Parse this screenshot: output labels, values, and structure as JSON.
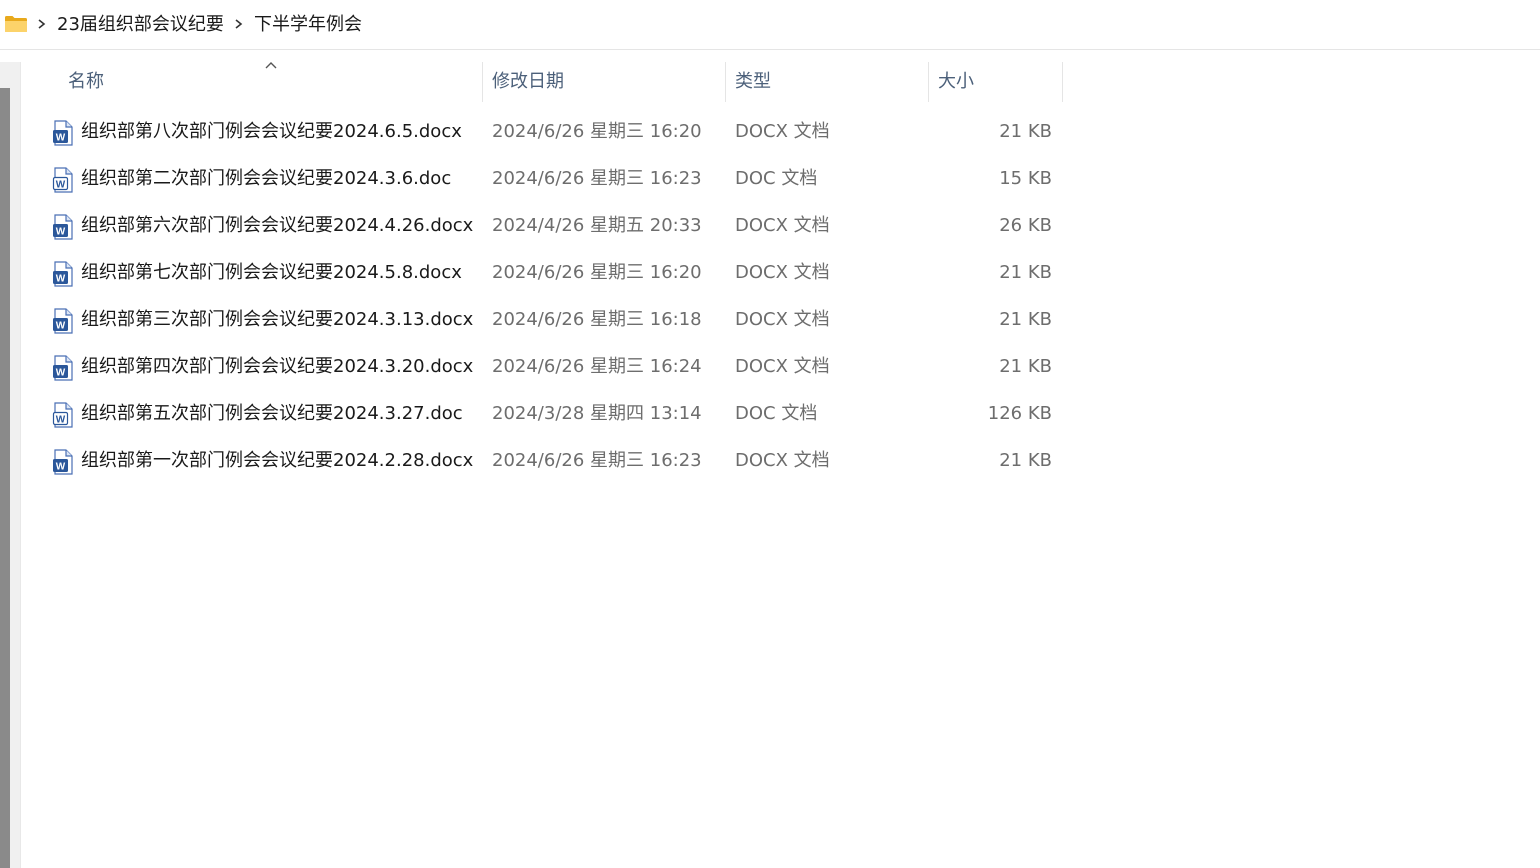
{
  "breadcrumb": {
    "items": [
      "23届组织部会议纪要",
      "下半学年例会"
    ]
  },
  "columns": {
    "name": "名称",
    "date": "修改日期",
    "type": "类型",
    "size": "大小"
  },
  "files": [
    {
      "name": "组织部第八次部门例会会议纪要2024.6.5.docx",
      "date": "2024/6/26 星期三 16:20",
      "type": "DOCX 文档",
      "size": "21 KB",
      "icon": "docx-icon"
    },
    {
      "name": "组织部第二次部门例会会议纪要2024.3.6.doc",
      "date": "2024/6/26 星期三 16:23",
      "type": "DOC 文档",
      "size": "15 KB",
      "icon": "doc-icon"
    },
    {
      "name": "组织部第六次部门例会会议纪要2024.4.26.docx",
      "date": "2024/4/26 星期五 20:33",
      "type": "DOCX 文档",
      "size": "26 KB",
      "icon": "docx-icon"
    },
    {
      "name": "组织部第七次部门例会会议纪要2024.5.8.docx",
      "date": "2024/6/26 星期三 16:20",
      "type": "DOCX 文档",
      "size": "21 KB",
      "icon": "docx-icon"
    },
    {
      "name": "组织部第三次部门例会会议纪要2024.3.13.docx",
      "date": "2024/6/26 星期三 16:18",
      "type": "DOCX 文档",
      "size": "21 KB",
      "icon": "docx-icon"
    },
    {
      "name": "组织部第四次部门例会会议纪要2024.3.20.docx",
      "date": "2024/6/26 星期三 16:24",
      "type": "DOCX 文档",
      "size": "21 KB",
      "icon": "docx-icon"
    },
    {
      "name": "组织部第五次部门例会会议纪要2024.3.27.doc",
      "date": "2024/3/28 星期四 13:14",
      "type": "DOC 文档",
      "size": "126 KB",
      "icon": "doc-icon"
    },
    {
      "name": "组织部第一次部门例会会议纪要2024.2.28.docx",
      "date": "2024/6/26 星期三 16:23",
      "type": "DOCX 文档",
      "size": "21 KB",
      "icon": "docx-icon"
    }
  ],
  "colors": {
    "word_blue": "#2b579a",
    "folder_yellow": "#f5c342",
    "header_text": "#4c607a"
  }
}
